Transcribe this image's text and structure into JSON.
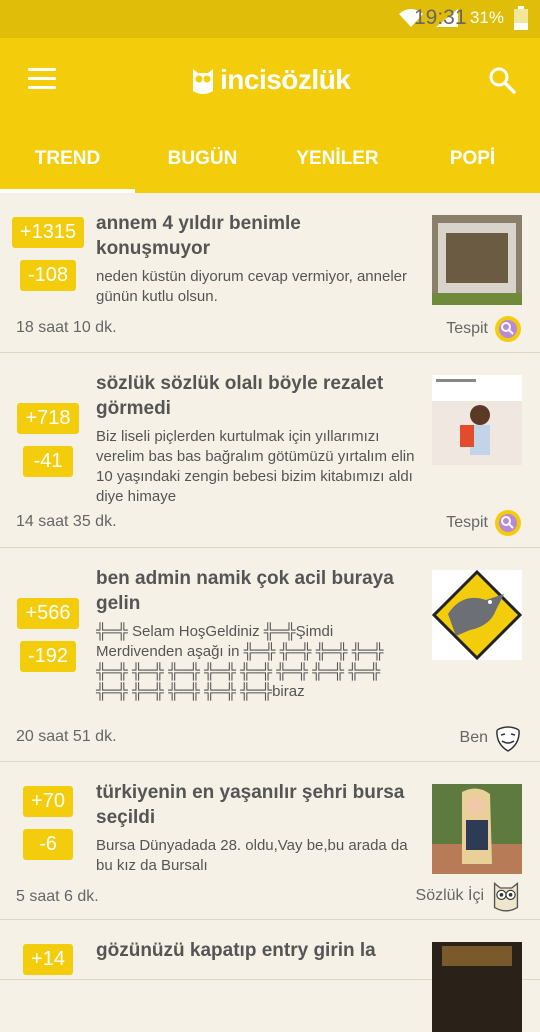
{
  "status": {
    "battery": "31%",
    "time": "19:31"
  },
  "app": {
    "logo_text": "incisözlük"
  },
  "tabs": [
    {
      "label": "TREND"
    },
    {
      "label": "BUGÜN"
    },
    {
      "label": "YENİLER"
    },
    {
      "label": "POPİ"
    }
  ],
  "posts": [
    {
      "up": "+1315",
      "down": "-108",
      "title": "annem 4 yıldır benimle konuşmuyor",
      "excerpt": "neden küstün diyorum cevap vermiyor, anneler günün kutlu olsun.",
      "time": "18 saat 10 dk.",
      "author": "Tespit"
    },
    {
      "up": "+718",
      "down": "-41",
      "title": "sözlük sözlük olalı böyle rezalet görmedi",
      "excerpt": "Biz liseli piçlerden kurtulmak için yıllarımızı verelim bas bas bağralım götümüzü yırtalım elin 10 yaşındaki zengin bebesi bizim kitabımızı aldı diye himaye",
      "time": "14 saat 35 dk.",
      "author": "Tespit"
    },
    {
      "up": "+566",
      "down": "-192",
      "title": "ben admin namik çok acil buraya gelin",
      "excerpt": "╬═╬ Selam HoşGeldiniz ╬═╬Şimdi Merdivenden aşağı in ╬═╬ ╬═╬ ╬═╬ ╬═╬ ╬═╬ ╬═╬ ╬═╬ ╬═╬ ╬═╬ ╬═╬ ╬═╬ ╬═╬ ╬═╬ ╬═╬ ╬═╬ ╬═╬ ╬═╬biraz",
      "time": "20 saat 51 dk.",
      "author": "Ben"
    },
    {
      "up": "+70",
      "down": "-6",
      "title": "türkiyenin en yaşanılır şehri bursa seçildi",
      "excerpt": "Bursa Dünyadada 28. oldu,Vay be,bu arada da bu kız da Bursalı",
      "time": "5 saat 6 dk.",
      "author": "Sözlük İçi"
    },
    {
      "up": "+14",
      "title": "gözünüzü kapatıp entry girin la"
    }
  ]
}
